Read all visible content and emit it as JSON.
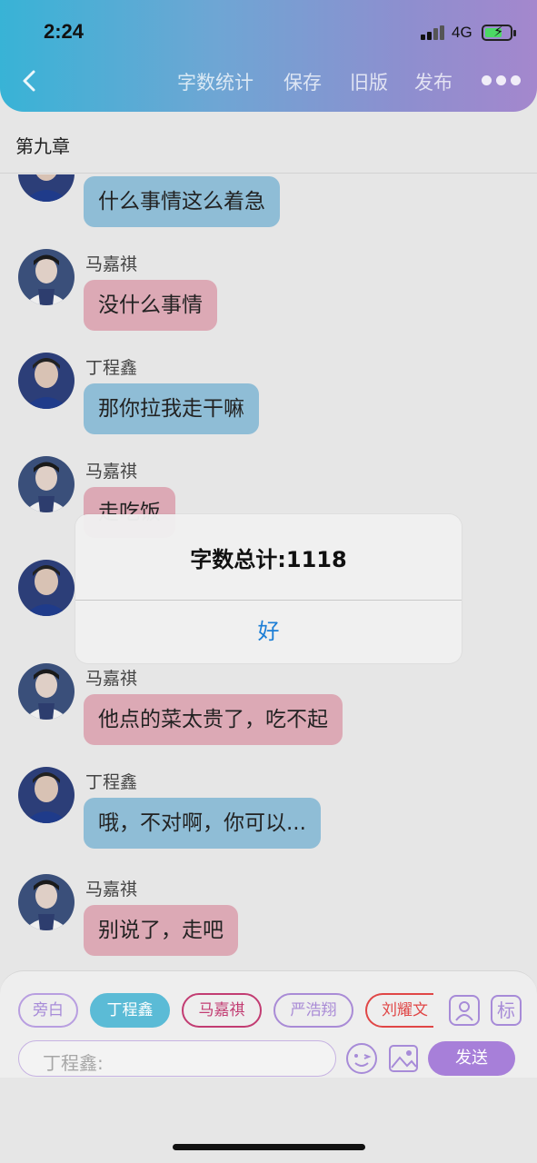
{
  "status_bar": {
    "time": "2:24",
    "network": "4G"
  },
  "nav": {
    "items": [
      "字数统计",
      "保存",
      "旧版",
      "发布"
    ]
  },
  "chapter_title": "第九章",
  "messages": [
    {
      "name": "",
      "text": "什么事情这么着急",
      "color": "blue"
    },
    {
      "name": "马嘉祺",
      "text": "没什么事情",
      "color": "pink"
    },
    {
      "name": "丁程鑫",
      "text": "那你拉我走干嘛",
      "color": "blue"
    },
    {
      "name": "马嘉祺",
      "text": "走吃饭",
      "color": "pink"
    },
    {
      "name": "",
      "text": "",
      "color": "blue"
    },
    {
      "name": "马嘉祺",
      "text": "他点的菜太贵了，吃不起",
      "color": "pink"
    },
    {
      "name": "丁程鑫",
      "text": "哦，不对啊，你可以...",
      "color": "blue"
    },
    {
      "name": "马嘉祺",
      "text": "别说了，走吧",
      "color": "pink"
    }
  ],
  "alert": {
    "title": "字数总计:1118",
    "confirm": "好"
  },
  "role_chips": [
    "旁白",
    "丁程鑫",
    "马嘉祺",
    "严浩翔",
    "刘耀文"
  ],
  "tools": {
    "person_icon_label": "",
    "tag_label": "标"
  },
  "composer": {
    "placeholder": "丁程鑫:",
    "send_label": "发送"
  },
  "colors": {
    "header_start": "#38b3d6",
    "header_end": "#a487cd",
    "bubble_blue": "#8fbdd6",
    "bubble_pink": "#dca9b5",
    "accent_purple": "#a77fd9",
    "alert_button": "#1c7ed6"
  }
}
